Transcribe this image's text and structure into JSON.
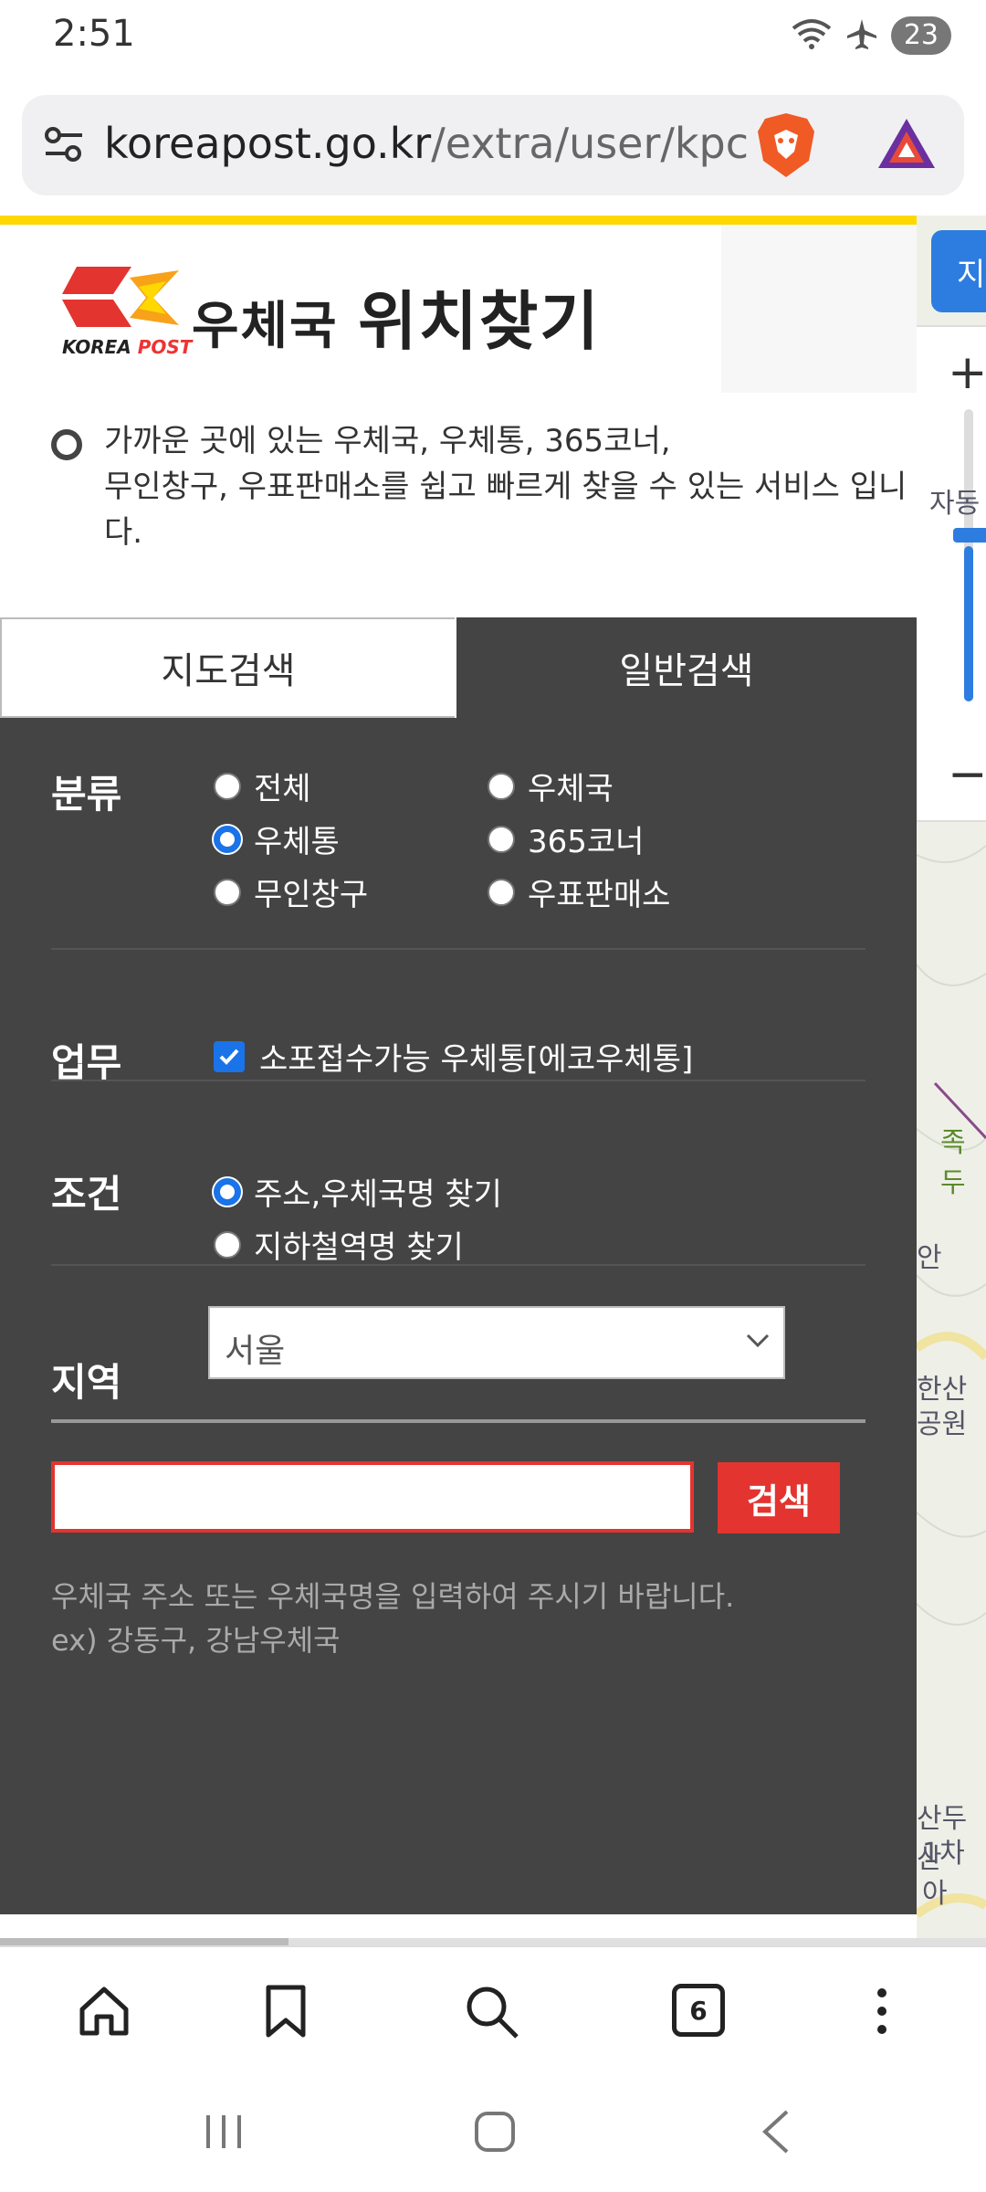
{
  "status_bar": {
    "time": "2:51",
    "battery": "23"
  },
  "address_bar": {
    "url_domain": "koreapost.go.kr",
    "url_path": "/extra/user/kpc"
  },
  "header": {
    "title_small": "우체국",
    "title_big": "위치찾기",
    "logo_text_a": "KOREA",
    "logo_text_b": "POST"
  },
  "description": {
    "line1": "가까운 곳에 있는 우체국, 우체통, 365코너,",
    "line2": "무인창구, 우표판매소를 쉽고 빠르게 찾을 수 있는 서비스 입니다."
  },
  "tabs": [
    {
      "label": "지도검색",
      "active": false
    },
    {
      "label": "일반검색",
      "active": true
    }
  ],
  "filters": {
    "category": {
      "label": "분류",
      "options": [
        {
          "label": "전체",
          "checked": false
        },
        {
          "label": "우체국",
          "checked": false
        },
        {
          "label": "우체통",
          "checked": true
        },
        {
          "label": "365코너",
          "checked": false
        },
        {
          "label": "무인창구",
          "checked": false
        },
        {
          "label": "우표판매소",
          "checked": false
        }
      ]
    },
    "business": {
      "label": "업무",
      "checkbox_label": "소포접수가능 우체통[에코우체통]",
      "checked": true
    },
    "condition": {
      "label": "조건",
      "options": [
        {
          "label": "주소,우체국명 찾기",
          "checked": true
        },
        {
          "label": "지하철역명 찾기",
          "checked": false
        }
      ]
    },
    "region": {
      "label": "지역",
      "selected": "서울"
    }
  },
  "search": {
    "input_value": "",
    "button_label": "검색",
    "hint_line1": "우체국 주소 또는 우체국명을 입력하여 주시기 바랍니다.",
    "hint_line2": "ex) 강동구, 강남우체국"
  },
  "map_strip": {
    "button_label": "지",
    "zoom_in": "+",
    "zoom_out": "−",
    "labels": [
      "자동",
      "족두",
      "안",
      "한산",
      "공원",
      "산두산",
      "1차아"
    ]
  },
  "toolbar": {
    "tab_count": "6"
  },
  "colors": {
    "accent_blue": "#1a73e8",
    "post_red": "#e3342f",
    "panel_dark": "#444444",
    "yellow_line": "#ffd800"
  }
}
